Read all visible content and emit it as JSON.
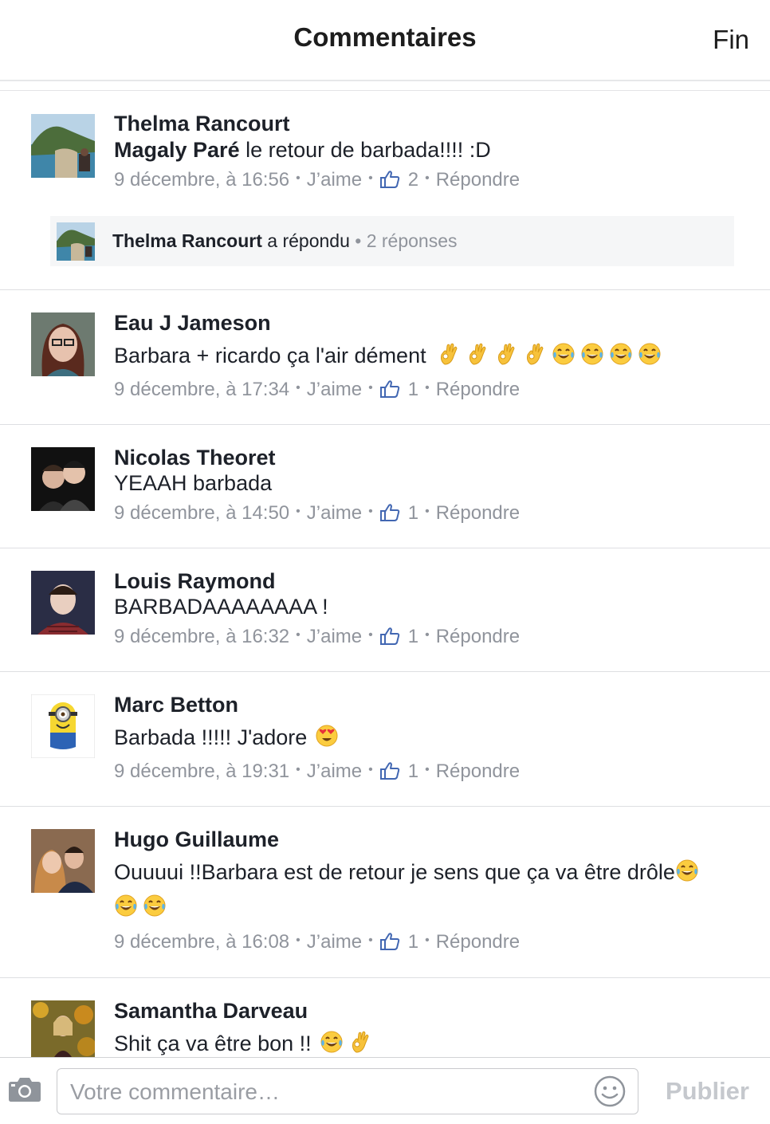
{
  "header": {
    "title": "Commentaires",
    "done_label": "Fin"
  },
  "comments": [
    {
      "author": "Thelma Rancourt",
      "mention": "Magaly Paré",
      "text": " le retour de barbada!!!! :D",
      "time": "9 décembre, à 16:56",
      "like_label": "J’aime",
      "likes": "2",
      "reply_label": "Répondre",
      "avatar_icon": "beach-island-photo",
      "replies": {
        "author": "Thelma Rancourt",
        "action": " a répondu",
        "count": "2 réponses"
      }
    },
    {
      "author": "Eau J Jameson",
      "text": "Barbara + ricardo ça l'air dément",
      "emojis": [
        "ok-hand-emoji",
        "ok-hand-emoji",
        "ok-hand-emoji",
        "ok-hand-emoji",
        "tears-of-joy-emoji",
        "tears-of-joy-emoji",
        "tears-of-joy-emoji",
        "tears-of-joy-emoji"
      ],
      "time": "9 décembre, à 17:34",
      "like_label": "J’aime",
      "likes": "1",
      "reply_label": "Répondre"
    },
    {
      "author": "Nicolas Theoret",
      "text": "YEAAH barbada",
      "time": "9 décembre, à 14:50",
      "like_label": "J’aime",
      "likes": "1",
      "reply_label": "Répondre"
    },
    {
      "author": "Louis Raymond",
      "text": "BARBADAAAAAAAA !",
      "time": "9 décembre, à 16:32",
      "like_label": "J’aime",
      "likes": "1",
      "reply_label": "Répondre"
    },
    {
      "author": "Marc Betton",
      "text": "Barbada !!!!! J'adore",
      "emojis": [
        "heart-eyes-emoji"
      ],
      "time": "9 décembre, à 19:31",
      "like_label": "J’aime",
      "likes": "1",
      "reply_label": "Répondre"
    },
    {
      "author": "Hugo Guillaume",
      "text": "Ouuuui !!Barbara est de retour je sens que ça va être drôle",
      "emojis": [
        "tears-of-joy-emoji",
        "tears-of-joy-emoji",
        "tears-of-joy-emoji"
      ],
      "time": "9 décembre, à 16:08",
      "like_label": "J’aime",
      "likes": "1",
      "reply_label": "Répondre"
    },
    {
      "author": "Samantha Darveau",
      "text": "Shit ça va être bon !!",
      "emojis": [
        "tears-of-joy-emoji",
        "ok-hand-emoji"
      ]
    }
  ],
  "composer": {
    "placeholder": "Votre commentaire…",
    "publish_label": "Publier"
  },
  "colors": {
    "thumb_blue": "#4267b2",
    "meta_gray": "#90949c",
    "reply_bg": "#f5f6f7"
  }
}
